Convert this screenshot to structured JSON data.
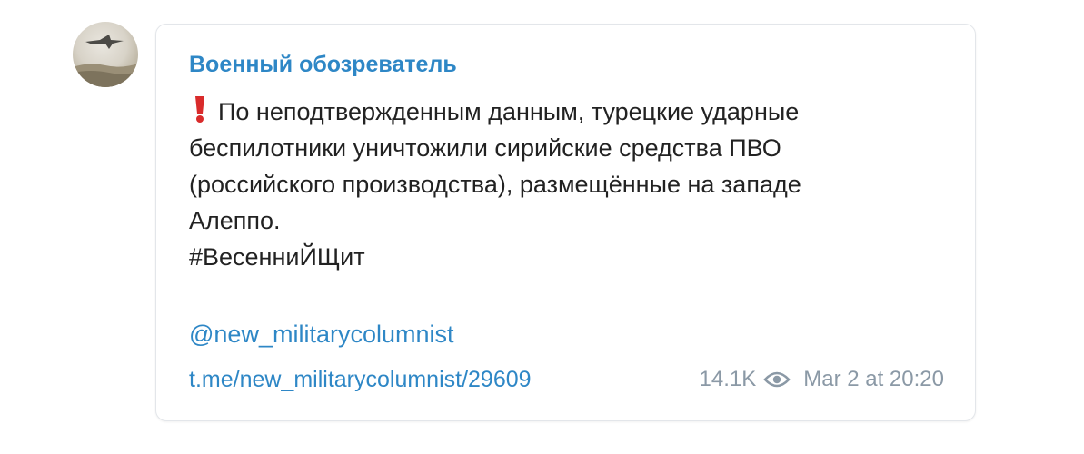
{
  "channel": {
    "name": "Военный обозреватель"
  },
  "message": {
    "lines": [
      "По неподтвержденным данным, турецкие ударные",
      "беспилотники уничтожили сирийские средства ПВО",
      "(российского производства), размещённые на западе",
      "Алеппо.",
      "#ВесенниЙЩит"
    ],
    "mention": "@new_militarycolumnist",
    "link": "t.me/new_militarycolumnist/29609"
  },
  "meta": {
    "views": "14.1K",
    "date": "Mar 2 at 20:20"
  },
  "icons": {
    "exclamation": "exclamation-icon",
    "views": "eye-icon"
  },
  "colors": {
    "link": "#2e87c6",
    "text": "#222222",
    "meta": "#8b99a6",
    "exclamation": "#d92b2b"
  }
}
